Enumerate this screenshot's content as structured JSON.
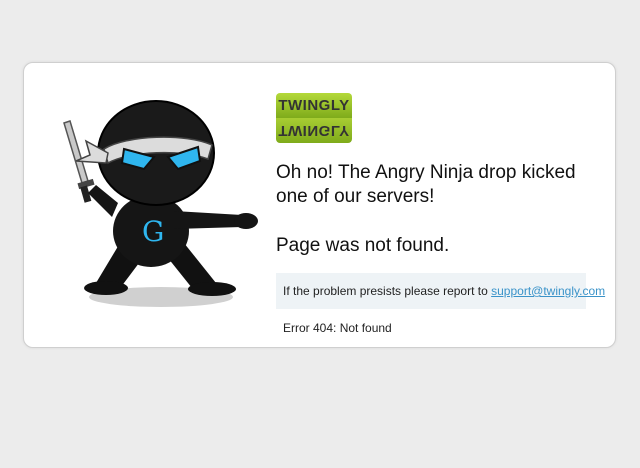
{
  "logo": {
    "text": "TWINGLY"
  },
  "message": {
    "headline": "Oh no! The Angry Ninja drop kicked one of our servers!",
    "not_found": "Page was not found."
  },
  "report": {
    "text": "If the problem presists please report to",
    "email": "support@twingly.com"
  },
  "error": {
    "text": "Error 404: Not found"
  },
  "ninja": {
    "chest_letter": "G"
  },
  "colors": {
    "logo_green": "#9dc52b",
    "link": "#3a93c9",
    "report_bg": "#eef3f6",
    "ninja_eyes": "#2fb6ef"
  }
}
